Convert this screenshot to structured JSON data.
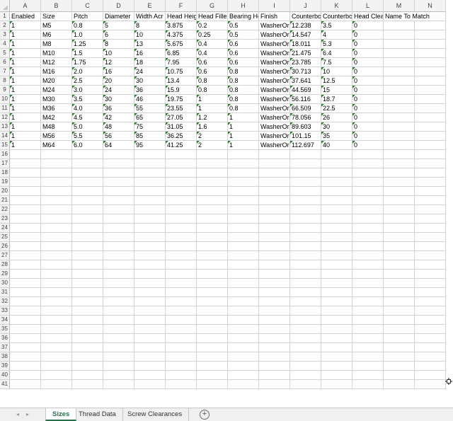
{
  "columns": [
    "A",
    "B",
    "C",
    "D",
    "E",
    "F",
    "G",
    "H",
    "I",
    "J",
    "K",
    "L",
    "M",
    "N"
  ],
  "row_numbers": [
    1,
    2,
    3,
    4,
    5,
    6,
    7,
    8,
    9,
    10,
    11,
    12,
    13,
    14,
    15,
    16,
    17,
    18,
    19,
    20,
    21,
    22,
    23,
    24,
    25,
    26,
    27,
    28,
    29,
    30,
    31,
    32,
    33,
    34,
    35,
    36,
    37,
    38,
    39,
    40,
    41
  ],
  "headers": [
    "Enabled",
    "Size",
    "Pitch",
    "Diameter",
    "Width Acr",
    "Head Heig",
    "Head Fille",
    "Bearing He",
    "Finish",
    "Counterbo",
    "Counterbo",
    "Head Clea",
    "Name To Match",
    ""
  ],
  "rows": [
    [
      "1",
      "M5",
      "0.8",
      "5",
      "8",
      "3.875",
      "0.2",
      "0.5",
      "WasherOr",
      "12.238",
      "3.5",
      "0"
    ],
    [
      "1",
      "M6",
      "1.0",
      "6",
      "10",
      "4.375",
      "0.25",
      "0.5",
      "WasherOr",
      "14.547",
      "4",
      "0"
    ],
    [
      "1",
      "M8",
      "1.25",
      "8",
      "13",
      "5.675",
      "0.4",
      "0.6",
      "WasherOr",
      "18.011",
      "5.3",
      "0"
    ],
    [
      "1",
      "M10",
      "1.5",
      "10",
      "16",
      "6.85",
      "0.4",
      "0.6",
      "WasherOr",
      "21.475",
      "6.4",
      "0"
    ],
    [
      "1",
      "M12",
      "1.75",
      "12",
      "18",
      "7.95",
      "0.6",
      "0.6",
      "WasherOr",
      "23.785",
      "7.5",
      "0"
    ],
    [
      "1",
      "M16",
      "2.0",
      "16",
      "24",
      "10.75",
      "0.6",
      "0.8",
      "WasherOr",
      "30.713",
      "10",
      "0"
    ],
    [
      "1",
      "M20",
      "2.5",
      "20",
      "30",
      "13.4",
      "0.8",
      "0.8",
      "WasherOr",
      "37.641",
      "12.5",
      "0"
    ],
    [
      "1",
      "M24",
      "3.0",
      "24",
      "36",
      "15.9",
      "0.8",
      "0.8",
      "WasherOr",
      "44.569",
      "15",
      "0"
    ],
    [
      "1",
      "M30",
      "3.5",
      "30",
      "46",
      "19.75",
      "1",
      "0.8",
      "WasherOr",
      "56.116",
      "18.7",
      "0"
    ],
    [
      "1",
      "M36",
      "4.0",
      "36",
      "55",
      "23.55",
      "1",
      "0.8",
      "WasherOr",
      "66.509",
      "22.5",
      "0"
    ],
    [
      "1",
      "M42",
      "4.5",
      "42",
      "65",
      "27.05",
      "1.2",
      "1",
      "WasherOr",
      "78.056",
      "26",
      "0"
    ],
    [
      "1",
      "M48",
      "5.0",
      "48",
      "75",
      "31.05",
      "1.6",
      "1",
      "WasherOr",
      "89.603",
      "30",
      "0"
    ],
    [
      "1",
      "M56",
      "5.5",
      "56",
      "85",
      "36.25",
      "2",
      "1",
      "WasherOr",
      "101.15",
      "35",
      "0"
    ],
    [
      "1",
      "M64",
      "6.0",
      "64",
      "95",
      "41.25",
      "2",
      "1",
      "WasherOr",
      "112.697",
      "40",
      "0"
    ]
  ],
  "tabs": [
    {
      "label": "Sizes",
      "active": true
    },
    {
      "label": "Thread Data",
      "active": false
    },
    {
      "label": "Screw Clearances",
      "active": false
    }
  ],
  "add_sheet_label": "+",
  "icons": {
    "nav_prev": "triangle-left",
    "nav_next": "triangle-right",
    "add_sheet": "plus-circle",
    "cursor": "crosshair-move"
  },
  "colors": {
    "accent": "#217346",
    "grid": "#d4d4d4",
    "error_indicator": "#2e7d32"
  }
}
